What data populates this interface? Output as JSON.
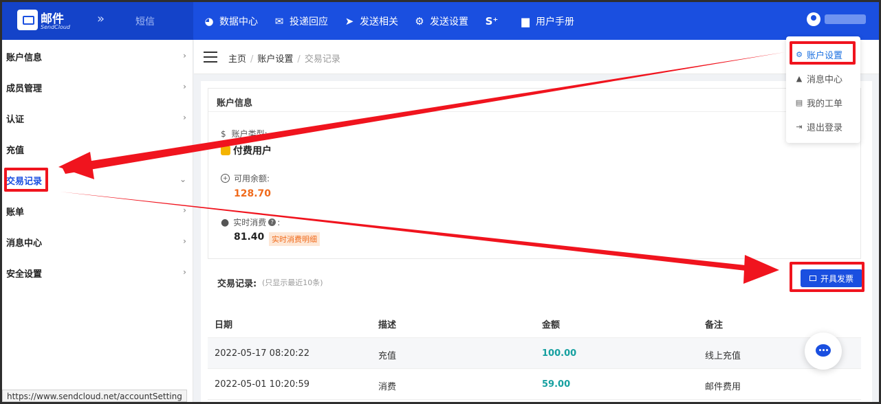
{
  "brand": {
    "name": "邮件",
    "sub": "SendCloud",
    "collapse": "»",
    "product": "短信"
  },
  "nav": [
    {
      "label": "数据中心",
      "icon": "pie-chart-icon",
      "glyph": "◕"
    },
    {
      "label": "投递回应",
      "icon": "inbox-icon",
      "glyph": "✉"
    },
    {
      "label": "发送相关",
      "icon": "send-icon",
      "glyph": "➤"
    },
    {
      "label": "发送设置",
      "icon": "gear-icon",
      "glyph": "⚙"
    },
    {
      "label": "",
      "icon": "s-plus-icon",
      "glyph": "S⁺"
    },
    {
      "label": "用户手册",
      "icon": "folder-icon",
      "glyph": "▆"
    }
  ],
  "sidebar": {
    "items": [
      {
        "label": "账户信息",
        "chevron": "›"
      },
      {
        "label": "成员管理",
        "chevron": "›"
      },
      {
        "label": "认证",
        "chevron": "›"
      },
      {
        "label": "充值",
        "chevron": ""
      },
      {
        "label": "交易记录",
        "chevron": "⌄"
      },
      {
        "label": "账单",
        "chevron": "›"
      },
      {
        "label": "消息中心",
        "chevron": "›"
      },
      {
        "label": "安全设置",
        "chevron": "›"
      }
    ],
    "active_index": 4
  },
  "status_url": "https://www.sendcloud.net/accountSetting",
  "breadcrumb": {
    "home": "主页",
    "sep": "/",
    "section": "账户设置",
    "current": "交易记录"
  },
  "account": {
    "title": "账户信息",
    "type_label": "账户类型:",
    "type_value": "付费用户",
    "balance_label": "可用余额:",
    "balance_value": "128.70",
    "realtime_label": "实时消费",
    "realtime_value": "81.40",
    "realtime_tag": "实时消费明细"
  },
  "records": {
    "title": "交易记录:",
    "note": "(只显示最近10条)",
    "invoice_button": "开具发票",
    "headers": [
      "日期",
      "描述",
      "金额",
      "备注"
    ],
    "rows": [
      [
        "2022-05-17 08:20:22",
        "充值",
        "100.00",
        "线上充值"
      ],
      [
        "2022-05-01 10:20:59",
        "消费",
        "59.00",
        "邮件费用"
      ]
    ]
  },
  "dropdown": [
    {
      "label": "账户设置",
      "glyph": "⚙"
    },
    {
      "label": "消息中心",
      "glyph": "▲"
    },
    {
      "label": "我的工单",
      "glyph": "▤"
    },
    {
      "label": "退出登录",
      "glyph": "⇥"
    }
  ],
  "colors": {
    "primary": "#1a4fe0",
    "annotation": "#f0141e",
    "orange": "#f06a1b",
    "teal": "#16a0a0"
  }
}
